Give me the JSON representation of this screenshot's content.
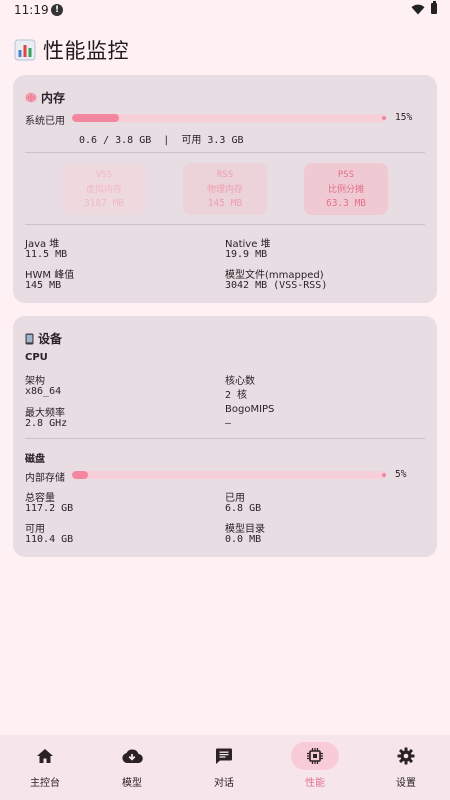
{
  "status_bar": {
    "time": "11:19"
  },
  "header": {
    "title": "性能监控"
  },
  "memory": {
    "title": "内存",
    "system_used_label": "系统已用",
    "system_used_percent": 0.15,
    "system_used_percent_text": "15%",
    "usage_detail": "0.6 / 3.8 GB  |  可用 3.3 GB",
    "stats": [
      {
        "name": "VSS",
        "desc": "虚拟内存",
        "value": "3187 MB"
      },
      {
        "name": "RSS",
        "desc": "物理内存",
        "value": "145 MB"
      },
      {
        "name": "PSS",
        "desc": "比例分摊",
        "value": "63.3 MB"
      }
    ],
    "java_heap_label": "Java 堆",
    "java_heap_value": "11.5 MB",
    "native_heap_label": "Native 堆",
    "native_heap_value": "19.9 MB",
    "hwm_label": "HWM 峰值",
    "hwm_value": "145 MB",
    "model_file_label": "模型文件(mmapped)",
    "model_file_value": "3042 MB (VSS-RSS)"
  },
  "device": {
    "title": "设备",
    "cpu_heading": "CPU",
    "arch_label": "架构",
    "arch_value": "x86_64",
    "cores_label": "核心数",
    "cores_value": "2 核",
    "max_freq_label": "最大频率",
    "max_freq_value": "2.8 GHz",
    "bogomips_label": "BogoMIPS",
    "bogomips_value": "—",
    "disk_heading": "磁盘",
    "internal_storage_label": "内部存储",
    "internal_storage_percent": 0.05,
    "internal_storage_percent_text": "5%",
    "total_label": "总容量",
    "total_value": "117.2 GB",
    "used_label": "已用",
    "used_value": "6.8 GB",
    "available_label": "可用",
    "available_value": "110.4 GB",
    "model_dir_label": "模型目录",
    "model_dir_value": "0.0 MB"
  },
  "nav": {
    "items": [
      {
        "label": "主控台",
        "icon": "home-icon"
      },
      {
        "label": "模型",
        "icon": "cloud-download-icon"
      },
      {
        "label": "对话",
        "icon": "chat-icon"
      },
      {
        "label": "性能",
        "icon": "chip-icon",
        "active": true
      },
      {
        "label": "设置",
        "icon": "gear-icon"
      }
    ]
  },
  "colors": {
    "background": "#fff0f3",
    "card": "#e8dde3",
    "accent": "#f4869f",
    "accent_text": "#e2738d"
  }
}
